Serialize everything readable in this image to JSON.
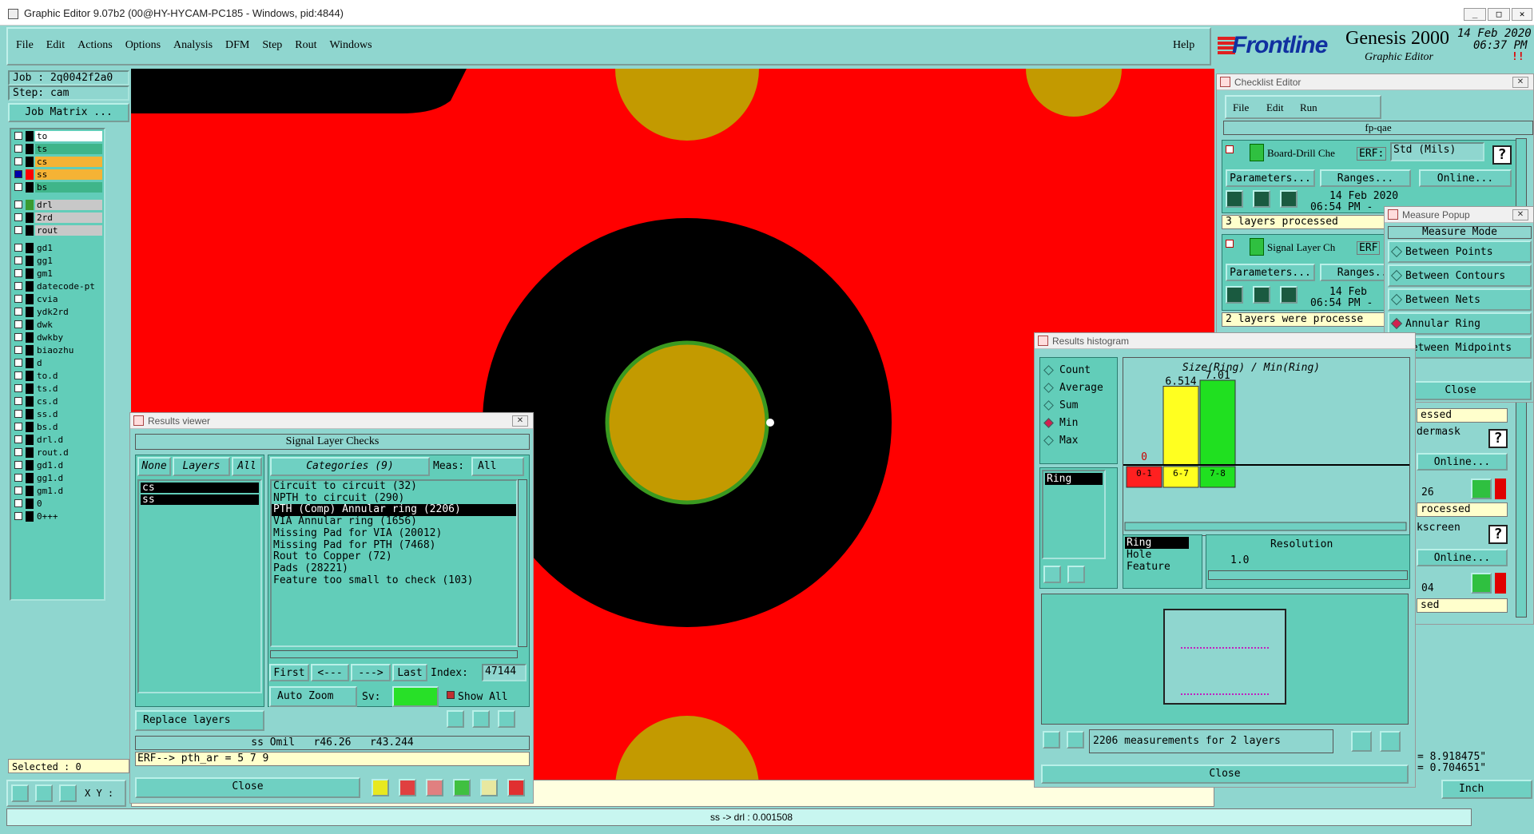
{
  "title_bar": {
    "title": "Graphic Editor 9.07b2 (00@HY-HYCAM-PC185 - Windows, pid:4844)",
    "min": "_",
    "max": "□",
    "close": "✕"
  },
  "menu": {
    "items": [
      "File",
      "Edit",
      "Actions",
      "Options",
      "Analysis",
      "DFM",
      "Step",
      "Rout",
      "Windows"
    ],
    "help": "Help"
  },
  "brand": {
    "logo": "Frontline",
    "product": "Genesis 2000",
    "subtitle": "Graphic Editor",
    "date": "14 Feb 2020",
    "time": "06:37 PM",
    "pause": "!!"
  },
  "job": {
    "job_label": "Job : 2q0042f2a0",
    "step_label": "Step: cam",
    "matrix_button": "Job Matrix ..."
  },
  "layers": {
    "group1": [
      {
        "name": "to",
        "color": "#ffffff",
        "side": "#000000"
      },
      {
        "name": "ts",
        "color": "#3fb58a",
        "side": "#000000"
      },
      {
        "name": "cs",
        "color": "#f5b335",
        "side": "#000000"
      },
      {
        "name": "ss",
        "color": "#f5b335",
        "side": "#ff0000",
        "mark": "#0000aa"
      },
      {
        "name": "bs",
        "color": "#3fb58a",
        "side": "#000000"
      }
    ],
    "group2": [
      {
        "name": "drl",
        "color": "#c8c8c8",
        "side": "#3a9a30"
      },
      {
        "name": "2rd",
        "color": "#c8c8c8",
        "side": "#000000"
      },
      {
        "name": "rout",
        "color": "#c8c8c8",
        "side": "#000000"
      }
    ],
    "group3": [
      "gd1",
      "gg1",
      "gm1",
      "datecode-pt",
      "cvia",
      "ydk2rd",
      "dwk",
      "dwkby",
      "biaozhu",
      "d",
      "to.d",
      "ts.d",
      "cs.d",
      "ss.d",
      "bs.d",
      "drl.d",
      "rout.d",
      "gd1.d",
      "gg1.d",
      "gm1.d",
      "0",
      "0+++"
    ]
  },
  "bottom_left": {
    "selected": "Selected : 0",
    "xy": "X Y :"
  },
  "status_bar": {
    "text": "ss -> drl : 0.001508"
  },
  "coords": {
    "x": "= 8.918475\"",
    "y": "= 0.704651\"",
    "units": "Inch"
  },
  "checklist_editor": {
    "title": "Checklist Editor",
    "menu": [
      "File",
      "Edit",
      "Run"
    ],
    "checklist_name": "fp-qae",
    "row1": {
      "name": "Board-Drill Che",
      "erf": "ERF:",
      "erf_value": "Std (Mils)",
      "help": "?",
      "params": "Parameters...",
      "ranges": "Ranges...",
      "online": "Online...",
      "date": "14 Feb 2020",
      "time": "06:54 PM -",
      "status": "3 layers processed"
    },
    "row2": {
      "name": "Signal Layer Ch",
      "erf": "ERF",
      "params": "Parameters...",
      "ranges": "Ranges...",
      "date": "14 Feb",
      "time": "06:54 PM -",
      "status": "2 layers were processe"
    },
    "row3": {
      "status": "essed",
      "name": "dermask",
      "help": "?",
      "online": "Online...",
      "date": "26",
      "status2": "rocessed"
    },
    "row4": {
      "name": "kscreen",
      "help": "?",
      "online": "Online...",
      "date": "04",
      "status": "sed"
    }
  },
  "measure_popup": {
    "title": "Measure Popup",
    "header": "Measure Mode",
    "options": [
      "Between Points",
      "Between Contours",
      "Between Nets",
      "Annular Ring",
      "Between Midpoints"
    ],
    "selected": "Annular Ring",
    "close": "Close"
  },
  "results_viewer": {
    "title": "Results viewer",
    "header": "Signal Layer Checks",
    "none": "None",
    "layers": "Layers",
    "all": "All",
    "categories": "Categories (9)",
    "meas_label": "Meas:",
    "meas_value": "All",
    "layer_list": [
      "cs",
      "ss"
    ],
    "category_list": [
      "Circuit to circuit (32)",
      "NPTH to circuit (290)",
      "PTH (Comp) Annular ring (2206)",
      "VIA Annular ring (1656)",
      "Missing Pad for VIA (20012)",
      "Missing Pad for PTH (7468)",
      "Rout to Copper (72)",
      "Pads (28221)",
      "Feature too small to check (103)"
    ],
    "selected_category": "PTH (Comp) Annular ring (2206)",
    "first": "First",
    "prev": "<---",
    "next": "--->",
    "last": "Last",
    "index_label": "Index:",
    "index_value": "47144",
    "auto_zoom": "Auto Zoom",
    "sv": "Sv:",
    "show_all": "Show All",
    "replace_layers": "Replace layers",
    "info_line": "ss Omil   r46.26   r43.244",
    "erf_line": "ERF--> pth_ar = 5 7 9",
    "close": "Close"
  },
  "histogram": {
    "title": "Results histogram",
    "stats": [
      "Count",
      "Average",
      "Sum",
      "Min",
      "Max"
    ],
    "selected_stat": "Min",
    "field_list": [
      "Ring"
    ],
    "chart_title": "Size(Ring) / Min(Ring)",
    "measure_list": [
      "Ring",
      "Hole",
      "Feature"
    ],
    "resolution_label": "Resolution",
    "resolution_value": "1.0",
    "summary": "2206 measurements for 2 layers",
    "close": "Close"
  },
  "chart_data": {
    "type": "bar",
    "title": "Size(Ring) / Min(Ring)",
    "categories": [
      "0-1",
      "6-7",
      "7-8"
    ],
    "values": [
      0,
      6.514,
      7.01
    ],
    "value_labels": [
      "0",
      "6.514",
      "7.01"
    ],
    "bar_colors": [
      "#ff2020",
      "#ffff20",
      "#20e020"
    ],
    "xlabel": "",
    "ylabel": "",
    "ylim": [
      0,
      7.01
    ]
  }
}
